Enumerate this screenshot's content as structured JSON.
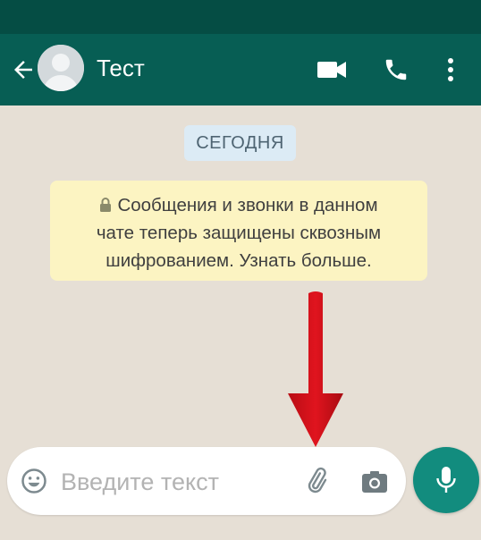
{
  "header": {
    "title": "Тест",
    "back_icon": "arrow-left-icon",
    "avatar_icon": "default-avatar-icon",
    "video_icon": "video-camera-icon",
    "call_icon": "phone-icon",
    "menu_icon": "more-vert-icon"
  },
  "chat": {
    "date_chip": "СЕГОДНЯ",
    "encryption_notice": {
      "line1": "Сообщения и звонки в данном",
      "line2": "чате теперь защищены сквозным",
      "line3": "шифрованием. Узнать больше."
    }
  },
  "composer": {
    "placeholder": "Введите текст",
    "emoji_icon": "emoji-smile-icon",
    "attach_icon": "paperclip-icon",
    "camera_icon": "camera-icon",
    "mic_icon": "microphone-icon"
  },
  "colors": {
    "toolbar": "#075e54",
    "status_bar": "#054d44",
    "chat_bg": "#e6dfd5",
    "notice_bg": "#fcf4c2",
    "date_chip_bg": "#dcebf5",
    "mic_button": "#128c7e",
    "annotation_arrow": "#d0101a"
  }
}
